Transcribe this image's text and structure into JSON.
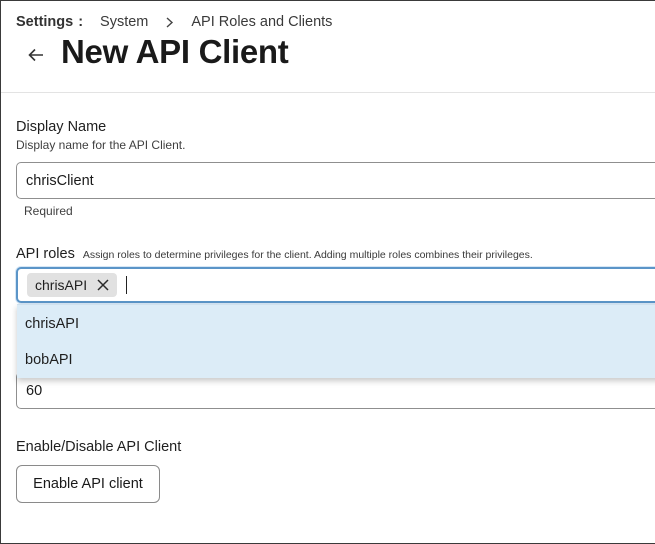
{
  "breadcrumb": {
    "root": "Settings",
    "separator": ":",
    "items": [
      "System",
      "API Roles and Clients"
    ]
  },
  "header": {
    "title": "New API Client"
  },
  "display_name": {
    "label": "Display Name",
    "help": "Display name for the API Client.",
    "value": "chrisClient",
    "required_text": "Required"
  },
  "api_roles": {
    "label": "API roles",
    "help": "Assign roles to determine privileges for the client. Adding multiple roles combines their privileges.",
    "selected": [
      "chrisAPI"
    ],
    "options": [
      "chrisAPI",
      "bobAPI"
    ]
  },
  "token_field": {
    "value": "60"
  },
  "enable_section": {
    "label": "Enable/Disable API Client",
    "button_label": "Enable API client"
  },
  "colors": {
    "focus_border": "#5b95c8",
    "dropdown_bg": "#dcecf7",
    "chip_bg": "#e1e1e1"
  },
  "icons": {
    "back": "arrow-left-icon",
    "breadcrumb_separator": "chevron-right-icon",
    "chip_remove": "close-icon"
  }
}
